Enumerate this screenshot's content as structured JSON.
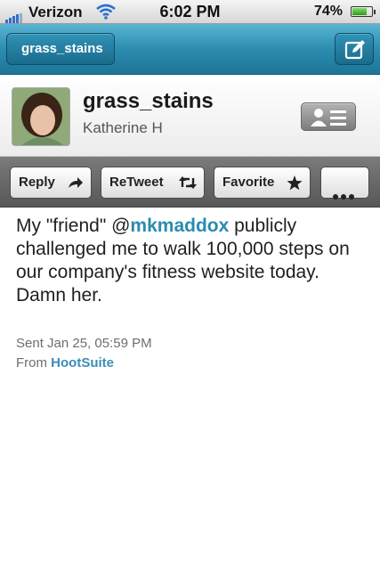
{
  "status_bar": {
    "carrier": "Verizon",
    "time": "6:02 PM",
    "battery_percent": "74%",
    "battery_level": 0.74
  },
  "nav": {
    "back_label": "grass_stains",
    "compose_icon": "compose-icon"
  },
  "profile": {
    "screen_name": "grass_stains",
    "full_name": "Katherine H",
    "contact_icon": "contact-card-icon"
  },
  "actions": {
    "reply_label": "Reply",
    "retweet_label": "ReTweet",
    "favorite_label": "Favorite",
    "more_icon": "more-icon"
  },
  "tweet": {
    "text_before": "My \"friend\" @",
    "mention": "mkmaddox",
    "text_after": " publicly challenged me to walk 100,000 steps on our company's fitness website today. Damn her.",
    "sent": "Sent Jan 25, 05:59 PM",
    "from_label": "From ",
    "source": "HootSuite"
  },
  "colors": {
    "nav_bar": "#2c8db0",
    "mention": "#2a8bb0",
    "action_bar": "#666666"
  }
}
